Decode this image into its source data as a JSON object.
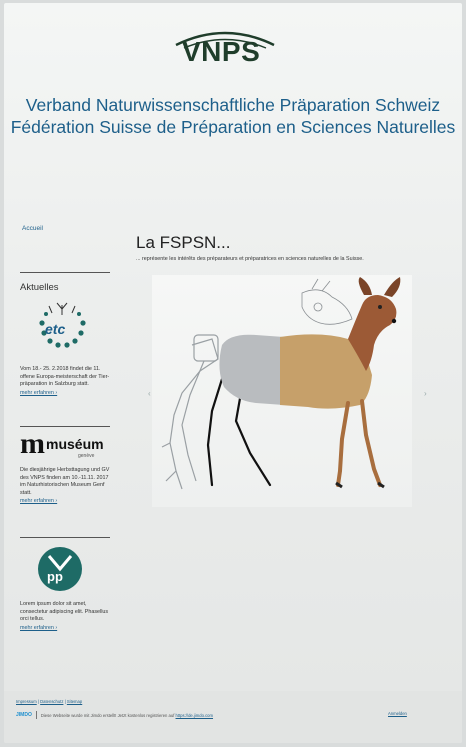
{
  "logo": {
    "text": "VNPS"
  },
  "header": {
    "title_de": "Verband Naturwissenschaftliche Präparation Schweiz",
    "title_fr": "Fédération Suisse de Préparation en Sciences Naturelles"
  },
  "sidebar": {
    "nav_home": "Accueil",
    "news_heading": "Aktuelles",
    "news": [
      {
        "logo_text": "etc",
        "text": "Vom 18.- 25. 2.2018 findet die 11. offene Europa-meisterschaft der Tier-präparation in Salzburg statt.",
        "more": "mehr erfahren ›"
      },
      {
        "logo_text": "muséum",
        "logo_sub": "genève",
        "text": "Die diesjährige Herbsttagung und GV des VNPS finden am 10.-11.11. 2017 im Naturhistorischen Museum Genf statt.",
        "more": "mehr erfahren ›"
      },
      {
        "logo_text": "VNPS",
        "text": "Lorem ipsum dolor sit amet, consectetur adipiscing elit. Phasellus orci tellus.",
        "more": "mehr erfahren ›"
      }
    ]
  },
  "main": {
    "title": "La FSPSN...",
    "subtitle": "... représente les intérêts des préparateurs et préparatrices en sciences naturelles de la Suisse.",
    "slider": {
      "prev": "‹",
      "next": "›"
    }
  },
  "footer": {
    "links": [
      "Impressum",
      "Datenschutz",
      "Sitemap"
    ],
    "jimdo": "JIMDO",
    "credit_text": "Diese Webseite wurde mit Jimdo erstellt! Jetzt kostenlos registrieren auf",
    "credit_link": "https://de.jimdo.com",
    "login": "Anmelden"
  },
  "colors": {
    "title_blue": "#1d5f8a",
    "logo_green": "#1f3d2b",
    "accent_teal": "#1e6b66"
  }
}
